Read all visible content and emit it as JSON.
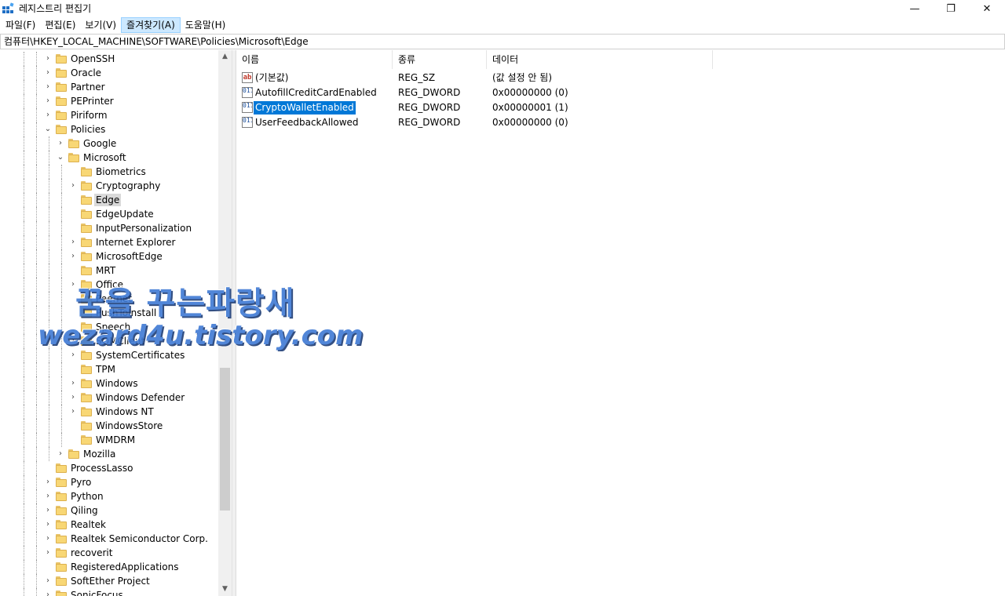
{
  "window": {
    "title": "레지스트리 편집기",
    "controls": {
      "minimize": "—",
      "maximize": "❐",
      "close": "✕"
    }
  },
  "menu": [
    {
      "label": "파일(F)",
      "active": false
    },
    {
      "label": "편집(E)",
      "active": false
    },
    {
      "label": "보기(V)",
      "active": false
    },
    {
      "label": "즐겨찾기(A)",
      "active": true
    },
    {
      "label": "도움말(H)",
      "active": false
    }
  ],
  "address": "컴퓨터\\HKEY_LOCAL_MACHINE\\SOFTWARE\\Policies\\Microsoft\\Edge",
  "tree": [
    {
      "label": "OpenSSH",
      "depth": 0,
      "expander": ">",
      "selected": false
    },
    {
      "label": "Oracle",
      "depth": 0,
      "expander": ">",
      "selected": false
    },
    {
      "label": "Partner",
      "depth": 0,
      "expander": ">",
      "selected": false
    },
    {
      "label": "PEPrinter",
      "depth": 0,
      "expander": ">",
      "selected": false
    },
    {
      "label": "Piriform",
      "depth": 0,
      "expander": ">",
      "selected": false
    },
    {
      "label": "Policies",
      "depth": 0,
      "expander": "v",
      "selected": false
    },
    {
      "label": "Google",
      "depth": 1,
      "expander": ">",
      "selected": false
    },
    {
      "label": "Microsoft",
      "depth": 1,
      "expander": "v",
      "selected": false
    },
    {
      "label": "Biometrics",
      "depth": 2,
      "expander": "",
      "selected": false
    },
    {
      "label": "Cryptography",
      "depth": 2,
      "expander": ">",
      "selected": false
    },
    {
      "label": "Edge",
      "depth": 2,
      "expander": "",
      "selected": true
    },
    {
      "label": "EdgeUpdate",
      "depth": 2,
      "expander": "",
      "selected": false
    },
    {
      "label": "InputPersonalization",
      "depth": 2,
      "expander": "",
      "selected": false
    },
    {
      "label": "Internet Explorer",
      "depth": 2,
      "expander": ">",
      "selected": false
    },
    {
      "label": "MicrosoftEdge",
      "depth": 2,
      "expander": ">",
      "selected": false
    },
    {
      "label": "MRT",
      "depth": 2,
      "expander": "",
      "selected": false
    },
    {
      "label": "Office",
      "depth": 2,
      "expander": ">",
      "selected": false
    },
    {
      "label": "Peernet",
      "depth": 2,
      "expander": "",
      "selected": false
    },
    {
      "label": "PushToInstall",
      "depth": 2,
      "expander": "",
      "selected": false
    },
    {
      "label": "Speech",
      "depth": 2,
      "expander": "",
      "selected": false
    },
    {
      "label": "SQMClient",
      "depth": 2,
      "expander": ">",
      "selected": false
    },
    {
      "label": "SystemCertificates",
      "depth": 2,
      "expander": ">",
      "selected": false
    },
    {
      "label": "TPM",
      "depth": 2,
      "expander": "",
      "selected": false
    },
    {
      "label": "Windows",
      "depth": 2,
      "expander": ">",
      "selected": false
    },
    {
      "label": "Windows Defender",
      "depth": 2,
      "expander": ">",
      "selected": false
    },
    {
      "label": "Windows NT",
      "depth": 2,
      "expander": ">",
      "selected": false
    },
    {
      "label": "WindowsStore",
      "depth": 2,
      "expander": "",
      "selected": false
    },
    {
      "label": "WMDRM",
      "depth": 2,
      "expander": "",
      "selected": false
    },
    {
      "label": "Mozilla",
      "depth": 1,
      "expander": ">",
      "selected": false
    },
    {
      "label": "ProcessLasso",
      "depth": 0,
      "expander": "",
      "selected": false
    },
    {
      "label": "Pyro",
      "depth": 0,
      "expander": ">",
      "selected": false
    },
    {
      "label": "Python",
      "depth": 0,
      "expander": ">",
      "selected": false
    },
    {
      "label": "Qiling",
      "depth": 0,
      "expander": ">",
      "selected": false
    },
    {
      "label": "Realtek",
      "depth": 0,
      "expander": ">",
      "selected": false
    },
    {
      "label": "Realtek Semiconductor Corp.",
      "depth": 0,
      "expander": ">",
      "selected": false
    },
    {
      "label": "recoverit",
      "depth": 0,
      "expander": ">",
      "selected": false
    },
    {
      "label": "RegisteredApplications",
      "depth": 0,
      "expander": "",
      "selected": false
    },
    {
      "label": "SoftEther Project",
      "depth": 0,
      "expander": ">",
      "selected": false
    },
    {
      "label": "SonicFocus",
      "depth": 0,
      "expander": ">",
      "selected": false
    }
  ],
  "columns": {
    "name": "이름",
    "type": "종류",
    "data": "데이터"
  },
  "values": [
    {
      "icon": "ab",
      "name": "(기본값)",
      "type": "REG_SZ",
      "data": "(값 설정 안 됨)",
      "selected": false
    },
    {
      "icon": "dword",
      "name": "AutofillCreditCardEnabled",
      "type": "REG_DWORD",
      "data": "0x00000000 (0)",
      "selected": false
    },
    {
      "icon": "dword",
      "name": "CryptoWalletEnabled",
      "type": "REG_DWORD",
      "data": "0x00000001 (1)",
      "selected": true
    },
    {
      "icon": "dword",
      "name": "UserFeedbackAllowed",
      "type": "REG_DWORD",
      "data": "0x00000000 (0)",
      "selected": false
    }
  ],
  "watermark": {
    "line1": "꿈을 꾸는파랑새",
    "line2": "wezard4u.tistory.com"
  },
  "colors": {
    "selection": "#0078d7",
    "tree_selection": "#d9d9d9",
    "menu_active": "#cce8ff",
    "watermark": "#3f7ad4"
  }
}
